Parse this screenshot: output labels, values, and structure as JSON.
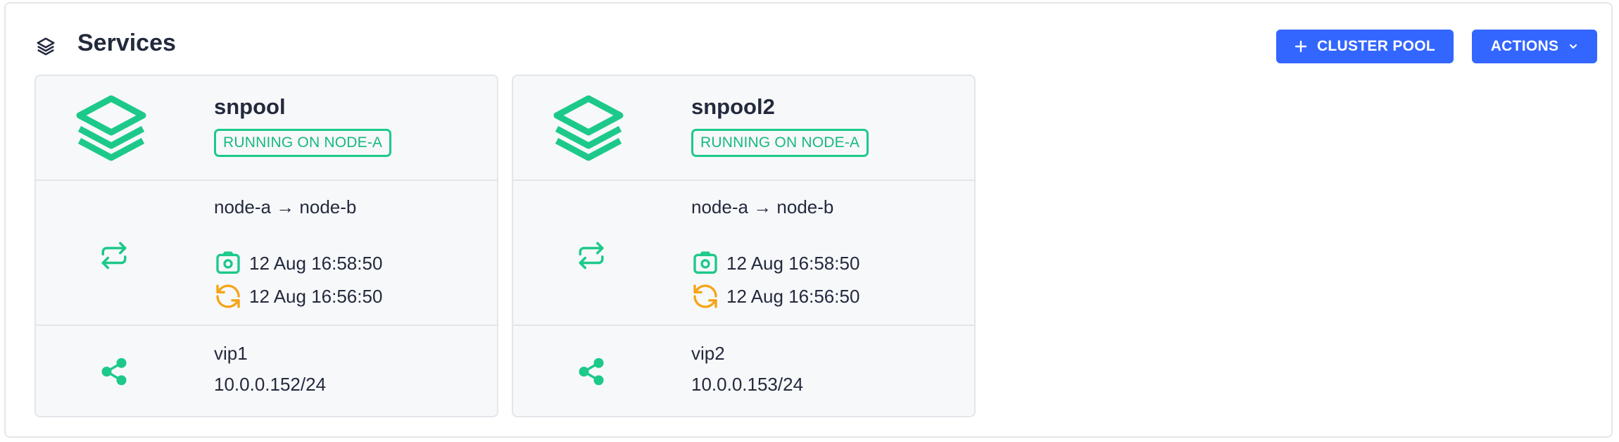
{
  "header": {
    "title": "Services",
    "icon": "layers-icon",
    "cluster_pool_label": "CLUSTER POOL",
    "actions_label": "ACTIONS"
  },
  "colors": {
    "accent": "#3366ff",
    "status_green": "#1dc98a",
    "sync_orange": "#f5a416"
  },
  "pools": [
    {
      "name": "snpool",
      "status": "RUNNING ON NODE-A",
      "route": "node-a → node-b",
      "snapshot_time": "12 Aug 16:58:50",
      "sync_time": "12 Aug 16:56:50",
      "vip_name": "vip1",
      "vip_address": "10.0.0.152/24"
    },
    {
      "name": "snpool2",
      "status": "RUNNING ON NODE-A",
      "route": "node-a → node-b",
      "snapshot_time": "12 Aug 16:58:50",
      "sync_time": "12 Aug 16:56:50",
      "vip_name": "vip2",
      "vip_address": "10.0.0.153/24"
    }
  ]
}
